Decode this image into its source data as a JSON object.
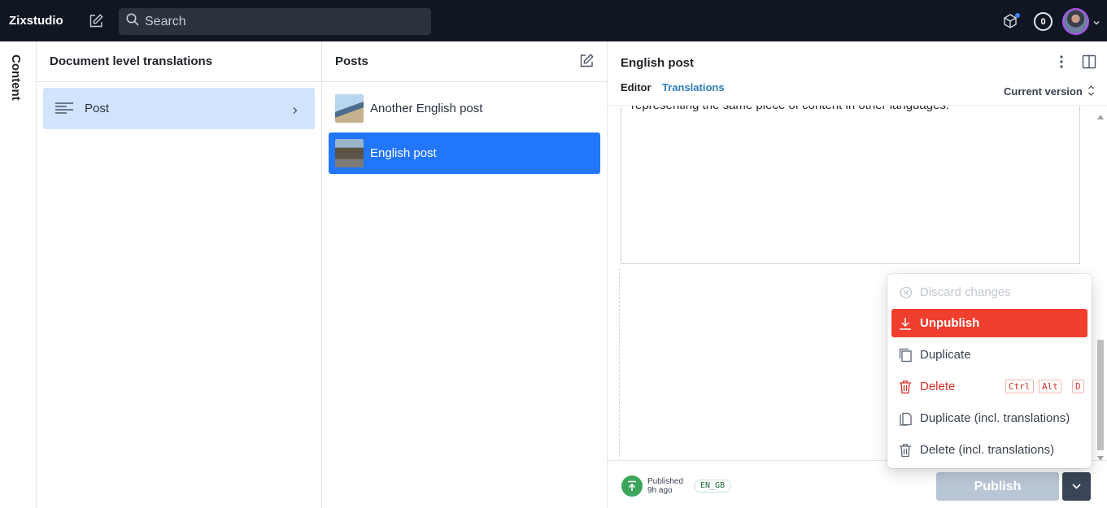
{
  "topbar": {
    "brand": "Zixstudio",
    "search_placeholder": "Search",
    "notification_count": "0",
    "icons": [
      "compose-icon",
      "search-icon",
      "cube-icon",
      "avatar",
      "chevron-down-icon"
    ]
  },
  "rail": {
    "label": "Content"
  },
  "pane1": {
    "title": "Document level translations",
    "items": [
      {
        "label": "Post",
        "icon": "lines-icon",
        "selected": true
      }
    ]
  },
  "pane2": {
    "title": "Posts",
    "documents": [
      {
        "label": "Another English post",
        "selected": false
      },
      {
        "label": "English post",
        "selected": true
      }
    ]
  },
  "pane3": {
    "title": "English post",
    "tabs": {
      "editor": "Editor",
      "translations": "Translations"
    },
    "version": "Current version",
    "editor_text": "representing the same piece of content in other languages.",
    "footer": {
      "status": "Published",
      "time": "9h ago",
      "locale": "EN_GB",
      "publish": "Publish"
    }
  },
  "menu": {
    "items": [
      {
        "label": "Discard changes",
        "state": "disabled"
      },
      {
        "label": "Unpublish",
        "state": "active-danger"
      },
      {
        "label": "Duplicate",
        "state": "normal"
      },
      {
        "label": "Delete",
        "state": "danger",
        "shortcut": [
          "Ctrl",
          "Alt",
          "D"
        ]
      },
      {
        "label": "Duplicate (incl. translations)",
        "state": "normal"
      },
      {
        "label": "Delete (incl. translations)",
        "state": "normal"
      }
    ]
  },
  "colors": {
    "topbar_bg": "#101722",
    "selected_blue": "#2276fc",
    "selected_light": "#d1e3fd",
    "danger": "#f03e2f",
    "published_green": "#3ca55c",
    "publish_disabled": "#b9c6d6"
  }
}
